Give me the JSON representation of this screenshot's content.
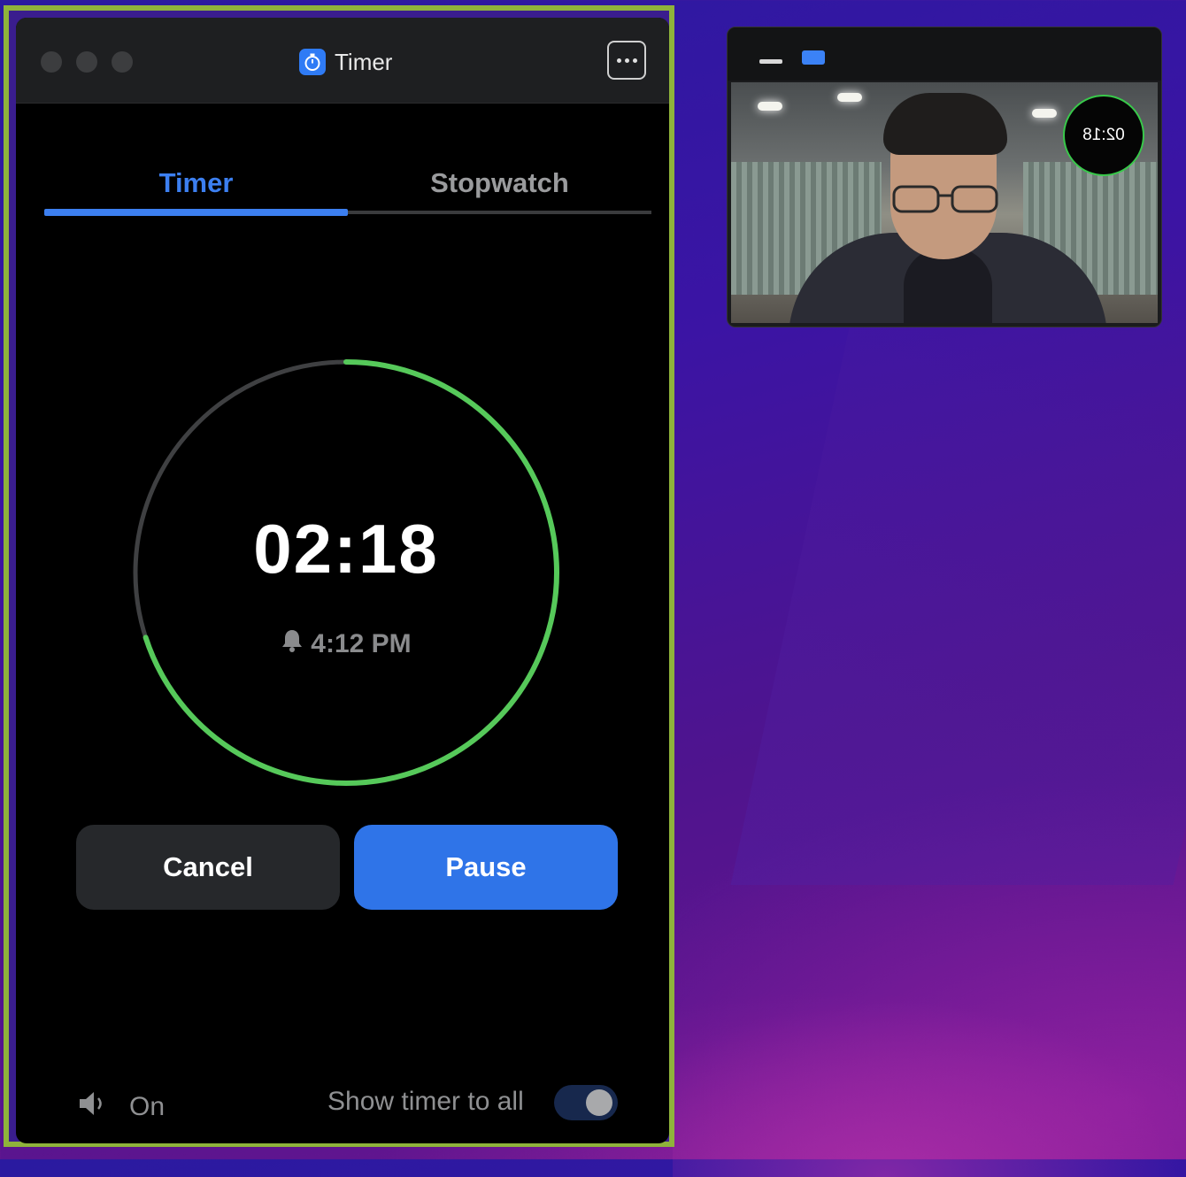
{
  "timer_window": {
    "title": "Timer",
    "tabs": [
      {
        "label": "Timer",
        "active": true
      },
      {
        "label": "Stopwatch",
        "active": false
      }
    ],
    "countdown": {
      "minutes": "02",
      "separator": ":",
      "seconds": "18",
      "remaining_fraction": 0.7
    },
    "alarm_time": "4:12 PM",
    "buttons": {
      "cancel": "Cancel",
      "pause": "Pause"
    },
    "sound": {
      "label": "On",
      "icon": "speaker-icon"
    },
    "show_timer": {
      "label": "Show timer to all",
      "enabled": true
    }
  },
  "video_window": {
    "overlay_time": "02:18"
  },
  "colors": {
    "accent_blue": "#2f74e8",
    "tab_blue": "#3c7ff0",
    "ring_green": "#56c95a",
    "ring_track": "#3f4042",
    "window_highlight": "#8fb33b"
  }
}
